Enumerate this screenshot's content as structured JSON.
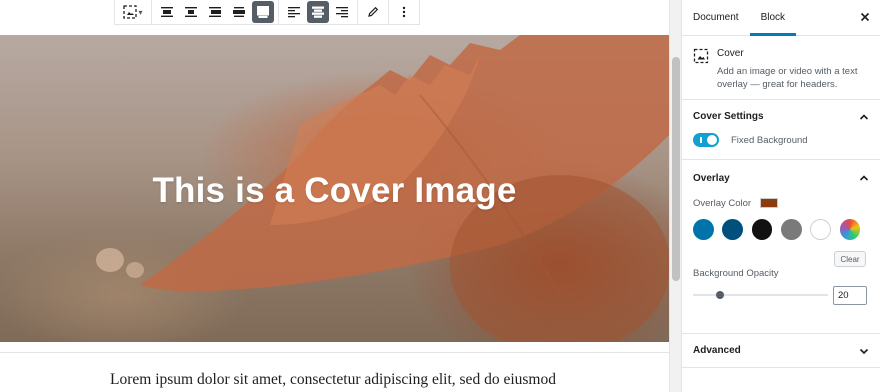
{
  "cover": {
    "title": "This is a Cover Image"
  },
  "content": {
    "paragraph": "Lorem ipsum dolor sit amet, consectetur adipiscing elit, sed do eiusmod"
  },
  "toolbar": {
    "block_type_icon": "cover-icon",
    "align_buttons": [
      "align-left-icon",
      "align-center-icon",
      "align-right-icon",
      "align-wide-icon",
      "align-full-icon"
    ],
    "text_align_buttons": [
      "text-align-left-icon",
      "text-align-center-icon",
      "text-align-right-icon"
    ],
    "edit_icon": "pencil-icon",
    "more_icon": "more-vertical-icon"
  },
  "sidebar": {
    "tabs": [
      {
        "label": "Document"
      },
      {
        "label": "Block"
      }
    ],
    "active_tab": "Block",
    "close_icon": "close-icon",
    "block_card": {
      "title": "Cover",
      "description": "Add an image or video with a text overlay — great for headers."
    },
    "cover_settings": {
      "title": "Cover Settings",
      "fixed_background_label": "Fixed Background",
      "fixed_background_on": true
    },
    "overlay": {
      "title": "Overlay",
      "color_label": "Overlay Color",
      "selected_color": "#8b3c0f",
      "palette": [
        "#0073aa",
        "#00507d",
        "#111111",
        "#7a7a7a",
        "#ffffff",
        "gradient"
      ],
      "clear_label": "Clear",
      "opacity_label": "Background Opacity",
      "opacity_value": "20",
      "opacity_fraction": 0.2
    },
    "advanced": {
      "title": "Advanced"
    }
  },
  "colors": {
    "accent": "#007cba",
    "toggle_on": "#11a0d2"
  }
}
